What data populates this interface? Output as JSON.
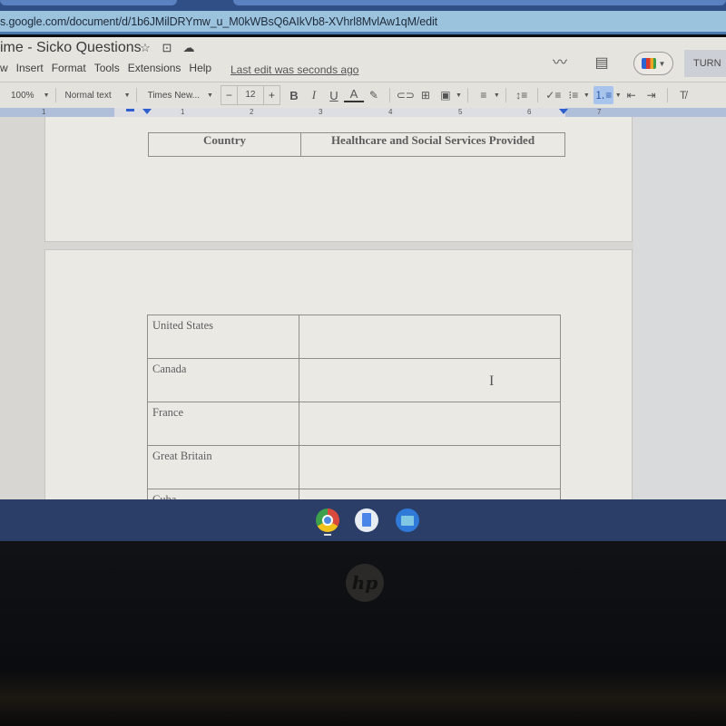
{
  "browser": {
    "url": "s.google.com/document/d/1b6JMilDRYmw_u_M0kWBsQ6AIkVb8-XVhrl8MvlAw1qM/edit"
  },
  "doc": {
    "title": "ime - Sicko Questions",
    "title_icons": [
      "star-icon",
      "move-to-folder-icon",
      "cloud-saved-icon"
    ],
    "menu": [
      "w",
      "Insert",
      "Format",
      "Tools",
      "Extensions",
      "Help"
    ],
    "last_edit": "Last edit was seconds ago",
    "right_icons": [
      "activity-trend-icon",
      "comments-icon",
      "meet-icon"
    ],
    "turn_in": "TURN"
  },
  "toolbar": {
    "zoom": "100%",
    "style": "Normal text",
    "font": "Times New...",
    "font_size": "12",
    "minus": "−",
    "plus": "+",
    "bold": "B",
    "italic": "I",
    "underline": "U",
    "text_color": "A",
    "icons": {
      "highlight": "✎",
      "link": "⊂⊃",
      "comment": "⊞",
      "image": "▣",
      "align": "≡",
      "line_spacing": "↕≡",
      "checklist": "✓≡",
      "bullets": "⁝≡",
      "numbered": "⒈≡",
      "indent_less": "⇤",
      "indent_more": "⇥",
      "clear_format": "T̸"
    }
  },
  "ruler": {
    "numbers": [
      "1",
      "1",
      "2",
      "3",
      "4",
      "5",
      "6",
      "7"
    ]
  },
  "table_header": {
    "col1": "Country",
    "col2": "Healthcare and Social Services Provided"
  },
  "table_rows": [
    {
      "country": "United States",
      "services": ""
    },
    {
      "country": "Canada",
      "services": ""
    },
    {
      "country": "France",
      "services": ""
    },
    {
      "country": "Great Britain",
      "services": ""
    },
    {
      "country": "Cuba",
      "services": ""
    }
  ],
  "shelf": {
    "apps": [
      "chrome-icon",
      "google-docs-icon",
      "files-icon"
    ]
  },
  "bezel": {
    "logo": "hp"
  }
}
